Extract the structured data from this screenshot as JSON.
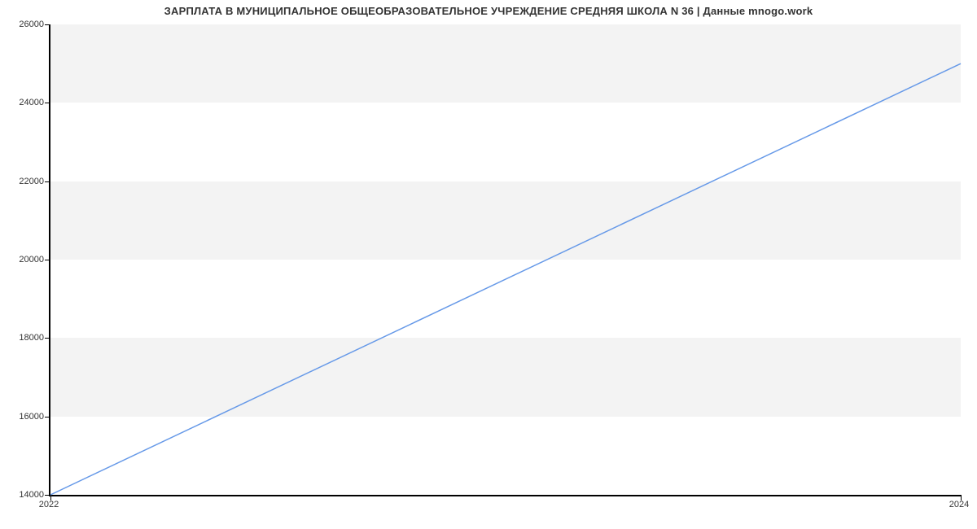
{
  "chart_data": {
    "type": "line",
    "title": "ЗАРПЛАТА В МУНИЦИПАЛЬНОЕ ОБЩЕОБРАЗОВАТЕЛЬНОЕ УЧРЕЖДЕНИЕ СРЕДНЯЯ ШКОЛА N 36 | Данные mnogo.work",
    "x": [
      2022,
      2024
    ],
    "values": [
      14000,
      25000
    ],
    "x_ticks": [
      2022,
      2024
    ],
    "y_ticks": [
      14000,
      16000,
      18000,
      20000,
      22000,
      24000,
      26000
    ],
    "xlim": [
      2022,
      2024
    ],
    "ylim": [
      14000,
      26000
    ],
    "xlabel": "",
    "ylabel": "",
    "line_color": "#6699e8",
    "band_color": "#f3f3f3"
  }
}
